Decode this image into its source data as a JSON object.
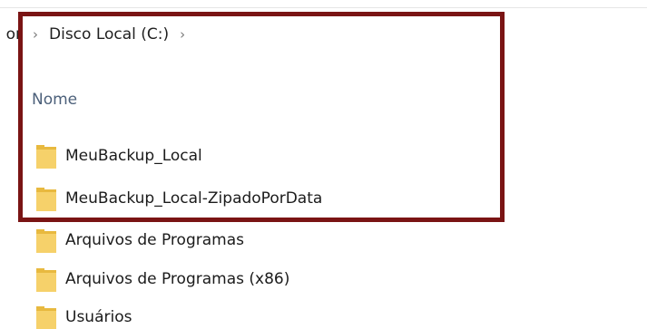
{
  "breadcrumb": {
    "previous": "or",
    "current": "Disco Local (C:)"
  },
  "header": {
    "name_column": "Nome"
  },
  "items": [
    {
      "label": "MeuBackup_Local"
    },
    {
      "label": "MeuBackup_Local-ZipadoPorData"
    },
    {
      "label": "Arquivos de Programas"
    },
    {
      "label": "Arquivos de Programas (x86)"
    },
    {
      "label": "Usuários"
    }
  ],
  "colors": {
    "folder": "#f6d16a",
    "folder_dark": "#e8b93f",
    "highlight_border": "#7a1414",
    "header_text": "#4c607a"
  }
}
